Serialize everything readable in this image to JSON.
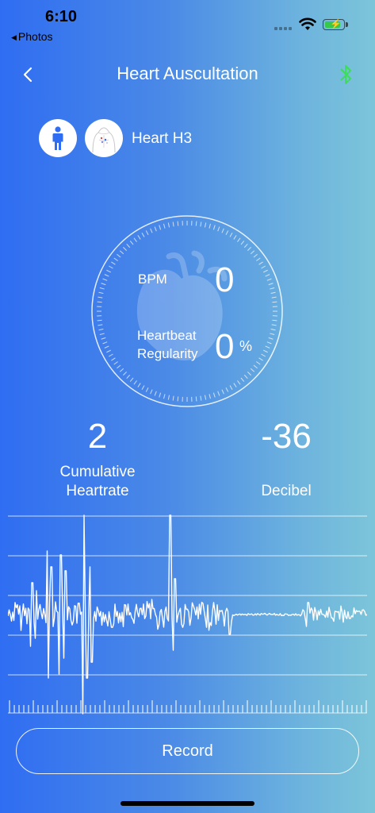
{
  "status_bar": {
    "time": "6:10",
    "back_app": "Photos"
  },
  "nav": {
    "title": "Heart Auscultation",
    "bluetooth_color": "#3ddc5b"
  },
  "position": {
    "label": "Heart H3"
  },
  "dial": {
    "bpm_label": "BPM",
    "bpm_value": "0",
    "regularity_label_line1": "Heartbeat",
    "regularity_label_line2": "Regularity",
    "regularity_value": "0",
    "regularity_unit": "%"
  },
  "stats": {
    "cumulative_value": "2",
    "cumulative_label_line1": "Cumulative",
    "cumulative_label_line2": "Heartrate",
    "decibel_value": "-36",
    "decibel_label": "Decibel"
  },
  "record": {
    "label": "Record"
  },
  "icons": [
    "back-chevron-icon",
    "bluetooth-icon",
    "person-icon",
    "chest-icon",
    "wifi-icon",
    "battery-icon",
    "heart-icon"
  ]
}
